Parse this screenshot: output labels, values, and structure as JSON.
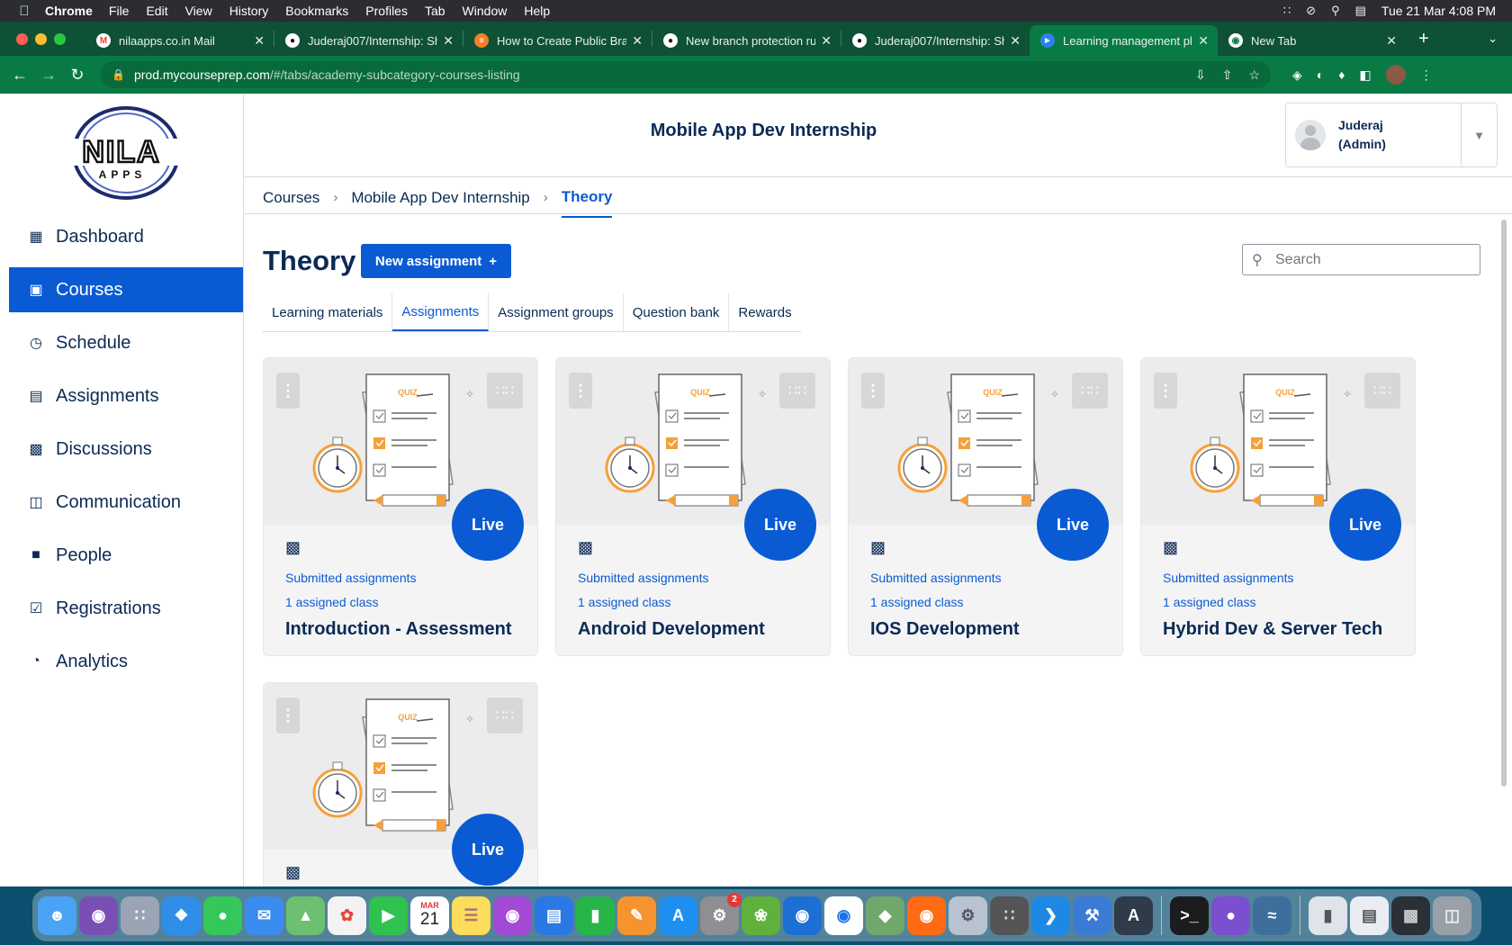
{
  "menubar": {
    "app_name": "Chrome",
    "items": [
      "File",
      "Edit",
      "View",
      "History",
      "Bookmarks",
      "Profiles",
      "Tab",
      "Window",
      "Help"
    ],
    "datetime": "Tue 21 Mar  4:08 PM"
  },
  "tabs": [
    {
      "title": "nilaapps.co.in Mail",
      "icon": "gmail-icon",
      "color": "#ea4335"
    },
    {
      "title": "Juderaj007/Internship: Sh",
      "icon": "github-icon",
      "color": "#ffffff"
    },
    {
      "title": "How to Create Public Bra",
      "icon": "stackoverflow-icon",
      "color": "#f48024"
    },
    {
      "title": "New branch protection ru",
      "icon": "github-icon",
      "color": "#ffffff"
    },
    {
      "title": "Juderaj007/Internship: Sh",
      "icon": "github-icon",
      "color": "#ffffff"
    },
    {
      "title": "Learning management pla",
      "icon": "vscode-icon",
      "color": "#2f80ed",
      "active": true
    },
    {
      "title": "New Tab",
      "icon": "chrome-icon",
      "color": "#ffffff"
    }
  ],
  "address": {
    "host": "prod.mycourseprep.com",
    "path": "/#/tabs/academy-subcategory-courses-listing"
  },
  "sidebar": {
    "items": [
      {
        "label": "Dashboard",
        "icon": "dashboard-icon"
      },
      {
        "label": "Courses",
        "icon": "book-icon",
        "active": true
      },
      {
        "label": "Schedule",
        "icon": "clock-icon"
      },
      {
        "label": "Assignments",
        "icon": "clipboard-icon"
      },
      {
        "label": "Discussions",
        "icon": "chat-icon"
      },
      {
        "label": "Communication",
        "icon": "message-icon"
      },
      {
        "label": "People",
        "icon": "person-icon"
      },
      {
        "label": "Registrations",
        "icon": "checklist-icon"
      },
      {
        "label": "Analytics",
        "icon": "pie-chart-icon"
      }
    ]
  },
  "header": {
    "course_title": "Mobile App Dev Internship",
    "user_name": "Juderaj",
    "user_role": "(Admin)"
  },
  "breadcrumb": [
    "Courses",
    "Mobile App Dev Internship",
    "Theory"
  ],
  "main": {
    "title": "Theory",
    "new_button": "New assignment",
    "search_placeholder": "Search",
    "tabs": [
      "Learning materials",
      "Assignments",
      "Assignment groups",
      "Question bank",
      "Rewards"
    ],
    "active_tab": "Assignments",
    "quiz_label": "QUIZ",
    "cards": [
      {
        "title": "Introduction - Assessment",
        "status": "Live",
        "link": "Submitted assignments",
        "assigned": "1 assigned class"
      },
      {
        "title": "Android Development",
        "status": "Live",
        "link": "Submitted assignments",
        "assigned": "1 assigned class"
      },
      {
        "title": "IOS Development",
        "status": "Live",
        "link": "Submitted assignments",
        "assigned": "1 assigned class"
      },
      {
        "title": "Hybrid Dev & Server Tech",
        "status": "Live",
        "link": "Submitted assignments",
        "assigned": "1 assigned class"
      },
      {
        "title": "",
        "status": "Live",
        "link": "",
        "assigned": ""
      }
    ]
  },
  "dock": {
    "calendar_month": "MAR",
    "calendar_day": "21",
    "settings_badge": "2"
  },
  "colors": {
    "brand_blue": "#0a5bd3",
    "navy": "#0b2a55",
    "chrome_green": "#0a7a45"
  }
}
